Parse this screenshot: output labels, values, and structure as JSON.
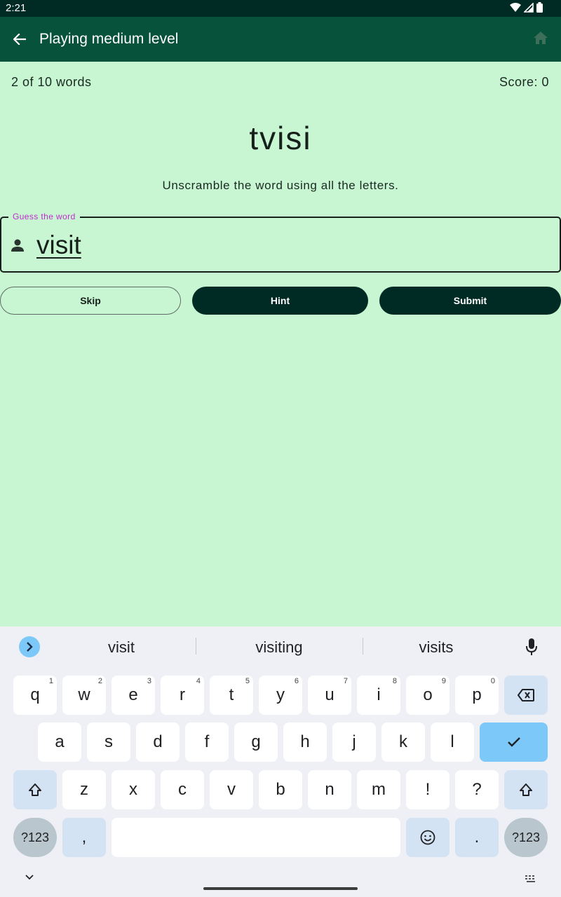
{
  "status_bar": {
    "time": "2:21"
  },
  "app_bar": {
    "title": "Playing medium level"
  },
  "game": {
    "progress": "2 of 10 words",
    "score": "Score: 0",
    "scrambled_word": "tvisi",
    "instructions": "Unscramble the word using all the letters."
  },
  "guess_field": {
    "label": "Guess the word",
    "value": "visit"
  },
  "buttons": {
    "skip": "Skip",
    "hint": "Hint",
    "submit": "Submit"
  },
  "keyboard": {
    "suggestions": [
      "visit",
      "visiting",
      "visits"
    ],
    "row1": [
      {
        "k": "q",
        "n": "1"
      },
      {
        "k": "w",
        "n": "2"
      },
      {
        "k": "e",
        "n": "3"
      },
      {
        "k": "r",
        "n": "4"
      },
      {
        "k": "t",
        "n": "5"
      },
      {
        "k": "y",
        "n": "6"
      },
      {
        "k": "u",
        "n": "7"
      },
      {
        "k": "i",
        "n": "8"
      },
      {
        "k": "o",
        "n": "9"
      },
      {
        "k": "p",
        "n": "0"
      }
    ],
    "row2": [
      "a",
      "s",
      "d",
      "f",
      "g",
      "h",
      "j",
      "k",
      "l"
    ],
    "row3": [
      "z",
      "x",
      "c",
      "v",
      "b",
      "n",
      "m",
      "!",
      "?"
    ],
    "symbols_label": "?123",
    "comma_label": ",",
    "period_label": "."
  },
  "colors": {
    "background": "#c8f5d2",
    "app_bar": "#07523a",
    "status_bar": "#002a24",
    "primary_button": "#002a24",
    "field_label": "#c02ad0",
    "keyboard_accent": "#7cc8f8"
  }
}
